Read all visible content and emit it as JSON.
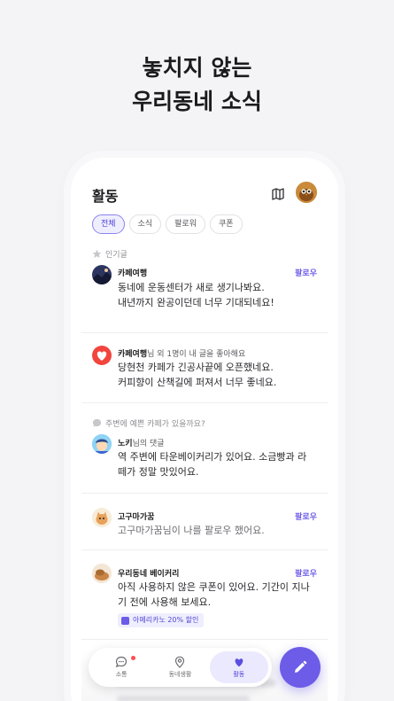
{
  "headline": {
    "line1": "놓치지 않는",
    "line2": "우리동네 소식"
  },
  "app": {
    "title": "활동"
  },
  "chips": [
    "전체",
    "소식",
    "팔로워",
    "쿠폰"
  ],
  "sections": {
    "popular": "인기글",
    "question": "주변에 예쁜 카페가 있을까요?"
  },
  "feed": {
    "item1": {
      "author": "카페여행",
      "follow": "팔로우",
      "line1": "동네에 운동센터가 새로 생기나봐요.",
      "line2": "내년까지 완공이던데 너무 기대되네요!"
    },
    "item2": {
      "author": "카페여행",
      "meta": "님 외 1명이 내 글을 좋아해요",
      "line1": "당현천 카페가 긴공사끝에 오픈했네요.",
      "line2": "커피향이 산책길에 퍼져서 너무 좋네요."
    },
    "item3": {
      "author": "노키",
      "meta": "님의 댓글",
      "line1": "역 주변에 타운베이커리가 있어요. 소금빵과 라",
      "line2": "떼가 정말 맛있어요."
    },
    "item4": {
      "author": "고구마가꿈",
      "follow": "팔로우",
      "line1": "고구마가꿈님이 나를 팔로우 했어요."
    },
    "item5": {
      "author": "우리동네 베이커리",
      "follow": "팔로우",
      "line1": "아직 사용하지 않은 쿠폰이 있어요. 기간이 지나",
      "line2": "기 전에 사용해 보세요.",
      "coupon": "아메리카노 20% 할인"
    }
  },
  "tabs": {
    "news": "소통",
    "local": "동네생활",
    "activity": "활동"
  },
  "colors": {
    "accent": "#6c5ce7",
    "heart": "#f2453d"
  },
  "icons": [
    "map-icon",
    "star-icon",
    "heart-icon",
    "chat-icon",
    "location-pin-icon",
    "pencil-icon"
  ]
}
